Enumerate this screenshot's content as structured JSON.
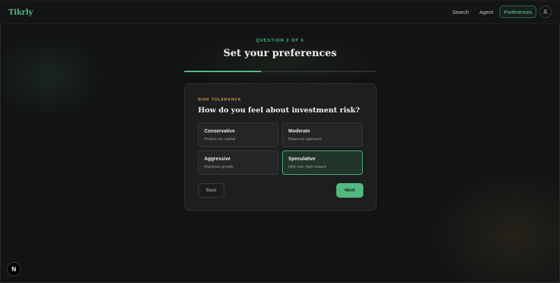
{
  "header": {
    "logo": "Tikrly",
    "nav": {
      "search": "Search",
      "agent": "Agent",
      "preferences": "Preferences"
    },
    "avatar_icon": "user-icon"
  },
  "main": {
    "step_label": "QUESTION 2 OF 5",
    "title": "Set your preferences",
    "progress": 0.4
  },
  "card": {
    "section_label": "RISK TOLERANCE",
    "question": "How do you feel about investment risk?",
    "options": [
      {
        "title": "Conservative",
        "description": "Protect my capital",
        "selected": false
      },
      {
        "title": "Moderate",
        "description": "Balanced approach",
        "selected": false
      },
      {
        "title": "Aggressive",
        "description": "Maximize growth",
        "selected": false
      },
      {
        "title": "Speculative",
        "description": "High risk, high reward",
        "selected": true
      }
    ],
    "back_label": "Back",
    "next_label": "Next"
  },
  "dev_badge": {
    "letter": "N",
    "icon": "nextjs-logo-icon"
  },
  "colors": {
    "accent": "#52b880",
    "section_label": "#d8a24a",
    "background": "#121314",
    "card": "#1d1e20"
  }
}
